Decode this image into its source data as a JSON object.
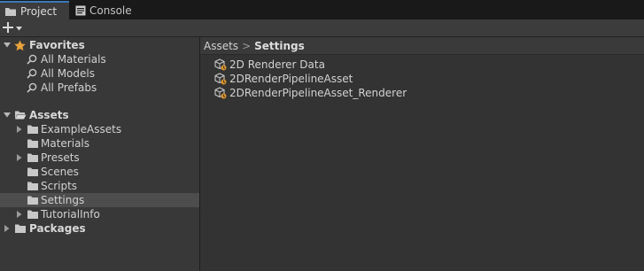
{
  "tabs": [
    {
      "label": "Project",
      "active": true,
      "icon": "folder-icon"
    },
    {
      "label": "Console",
      "active": false,
      "icon": "console-icon"
    }
  ],
  "toolbar": {
    "add_label": "+",
    "add_icon": "plus-icon"
  },
  "tree": {
    "favorites": {
      "label": "Favorites",
      "items": [
        "All Materials",
        "All Models",
        "All Prefabs"
      ]
    },
    "assets": {
      "label": "Assets",
      "items": [
        {
          "label": "ExampleAssets",
          "expandable": true
        },
        {
          "label": "Materials",
          "expandable": false
        },
        {
          "label": "Presets",
          "expandable": true
        },
        {
          "label": "Scenes",
          "expandable": false
        },
        {
          "label": "Scripts",
          "expandable": false
        },
        {
          "label": "Settings",
          "expandable": false,
          "selected": true
        },
        {
          "label": "TutorialInfo",
          "expandable": true
        }
      ]
    },
    "packages": {
      "label": "Packages"
    }
  },
  "breadcrumb": {
    "root": "Assets",
    "separator": ">",
    "current": "Settings"
  },
  "assets_list": [
    "2D Renderer Data",
    "2DRenderPipelineAsset",
    "2DRenderPipelineAsset_Renderer"
  ],
  "colors": {
    "accent": "#3a79bb",
    "favorite_star": "#e8a33a",
    "selection": "#4d4d4d"
  }
}
